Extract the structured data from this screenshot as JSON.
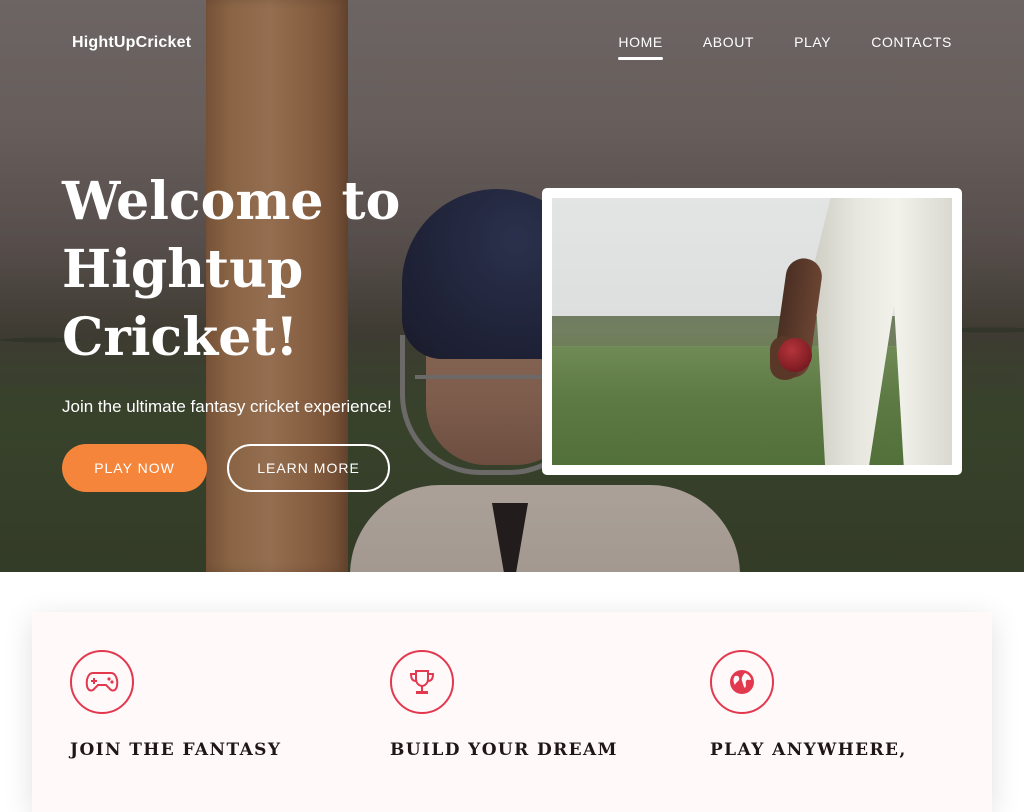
{
  "brand": "HightUpCricket",
  "nav": {
    "items": [
      {
        "label": "HOME",
        "active": true
      },
      {
        "label": "ABOUT",
        "active": false
      },
      {
        "label": "PLAY",
        "active": false
      },
      {
        "label": "CONTACTS",
        "active": false
      }
    ]
  },
  "hero": {
    "headline": "Welcome to Hightup Cricket!",
    "tagline": "Join the ultimate fantasy cricket experience!",
    "primary_button": "PLAY NOW",
    "secondary_button": "LEARN MORE"
  },
  "features": [
    {
      "icon": "gamepad-icon",
      "title": "JOIN THE FANTASY"
    },
    {
      "icon": "trophy-icon",
      "title": "BUILD YOUR DREAM"
    },
    {
      "icon": "globe-icon",
      "title": "PLAY ANYWHERE,"
    }
  ],
  "colors": {
    "accent_orange": "#f5853b",
    "accent_red": "#e2394f",
    "feature_bg": "#fff9fa"
  }
}
